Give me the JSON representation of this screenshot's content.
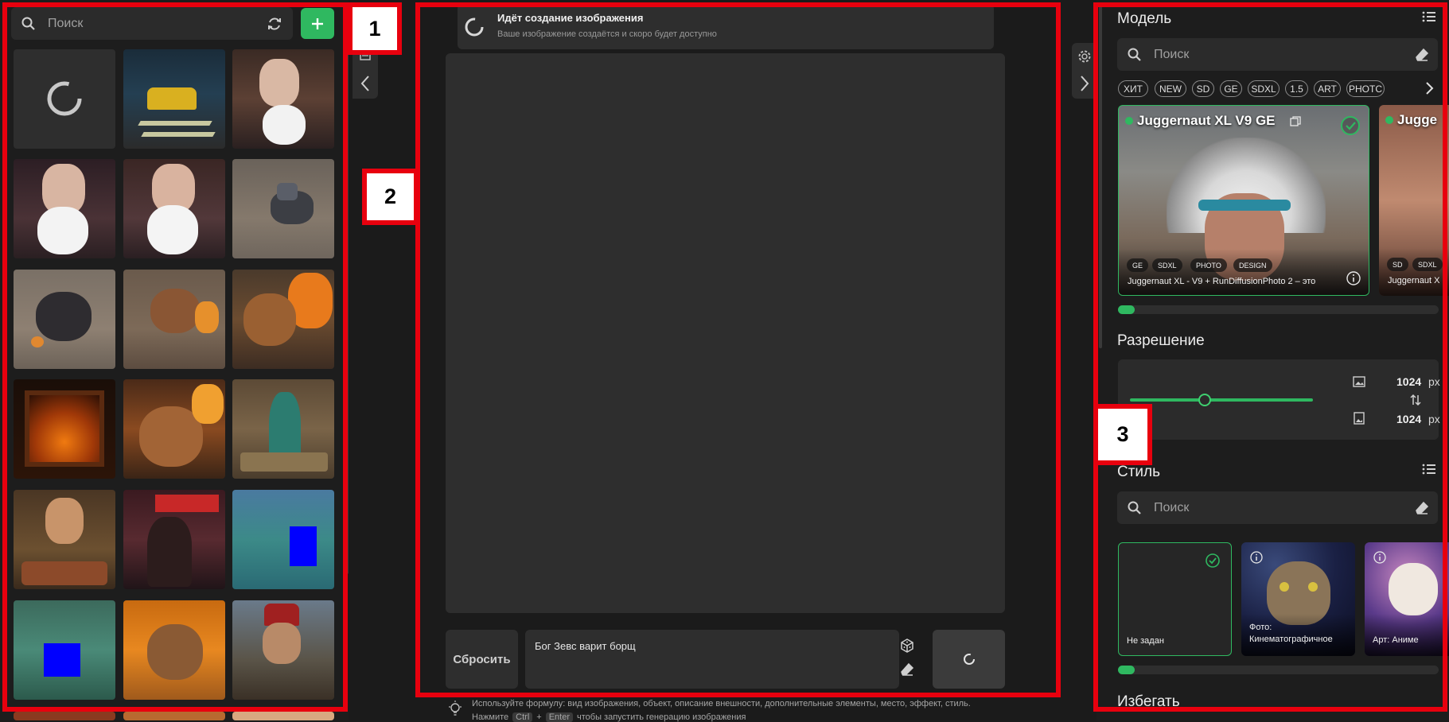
{
  "gallery": {
    "search_placeholder": "Поиск"
  },
  "annotations": [
    "1",
    "2",
    "3"
  ],
  "status": {
    "title": "Идёт создание изображения",
    "subtitle": "Ваше изображение создаётся и скоро будет доступно"
  },
  "prompt": {
    "reset_label": "Сбросить",
    "text": "Бог Зевс варит борщ",
    "hint_line1": "Используйте формулу: вид изображения, объект, описание внешности, дополнительные элементы, место, эффект, стиль.",
    "hint_line2_a": "Нажмите",
    "hint_key1": "Ctrl",
    "hint_plus": "+",
    "hint_key2": "Enter",
    "hint_line2_b": "чтобы запустить генерацию изображения"
  },
  "model": {
    "section_title": "Модель",
    "search_placeholder": "Поиск",
    "chips": [
      "ХИТ",
      "NEW",
      "SD",
      "GE",
      "SDXL",
      "1.5",
      "ART",
      "PHOTC"
    ],
    "card1": {
      "name": "Juggernaut XL V9 GE",
      "tags": [
        "GE",
        "SDXL",
        "PHOTO",
        "DESIGN"
      ],
      "description": "Juggernaut XL - V9 + RunDiffusionPhoto 2 – это"
    },
    "card2": {
      "name": "Jugge",
      "tags": [
        "SD",
        "SDXL"
      ],
      "description": "Juggernaut X"
    }
  },
  "resolution": {
    "section_title": "Разрешение",
    "width_value": "1024",
    "height_value": "1024",
    "unit": "px",
    "slider_level": 0.41
  },
  "style": {
    "section_title": "Стиль",
    "search_placeholder": "Поиск",
    "cards": [
      {
        "label": "Не задан"
      },
      {
        "label": "Фото:\nКинематографичное"
      },
      {
        "label": "Арт: Аниме"
      }
    ]
  },
  "avoid": {
    "section_title": "Избегать"
  },
  "colors": {
    "accent": "#2fb860",
    "highlight": "#e8000e"
  }
}
